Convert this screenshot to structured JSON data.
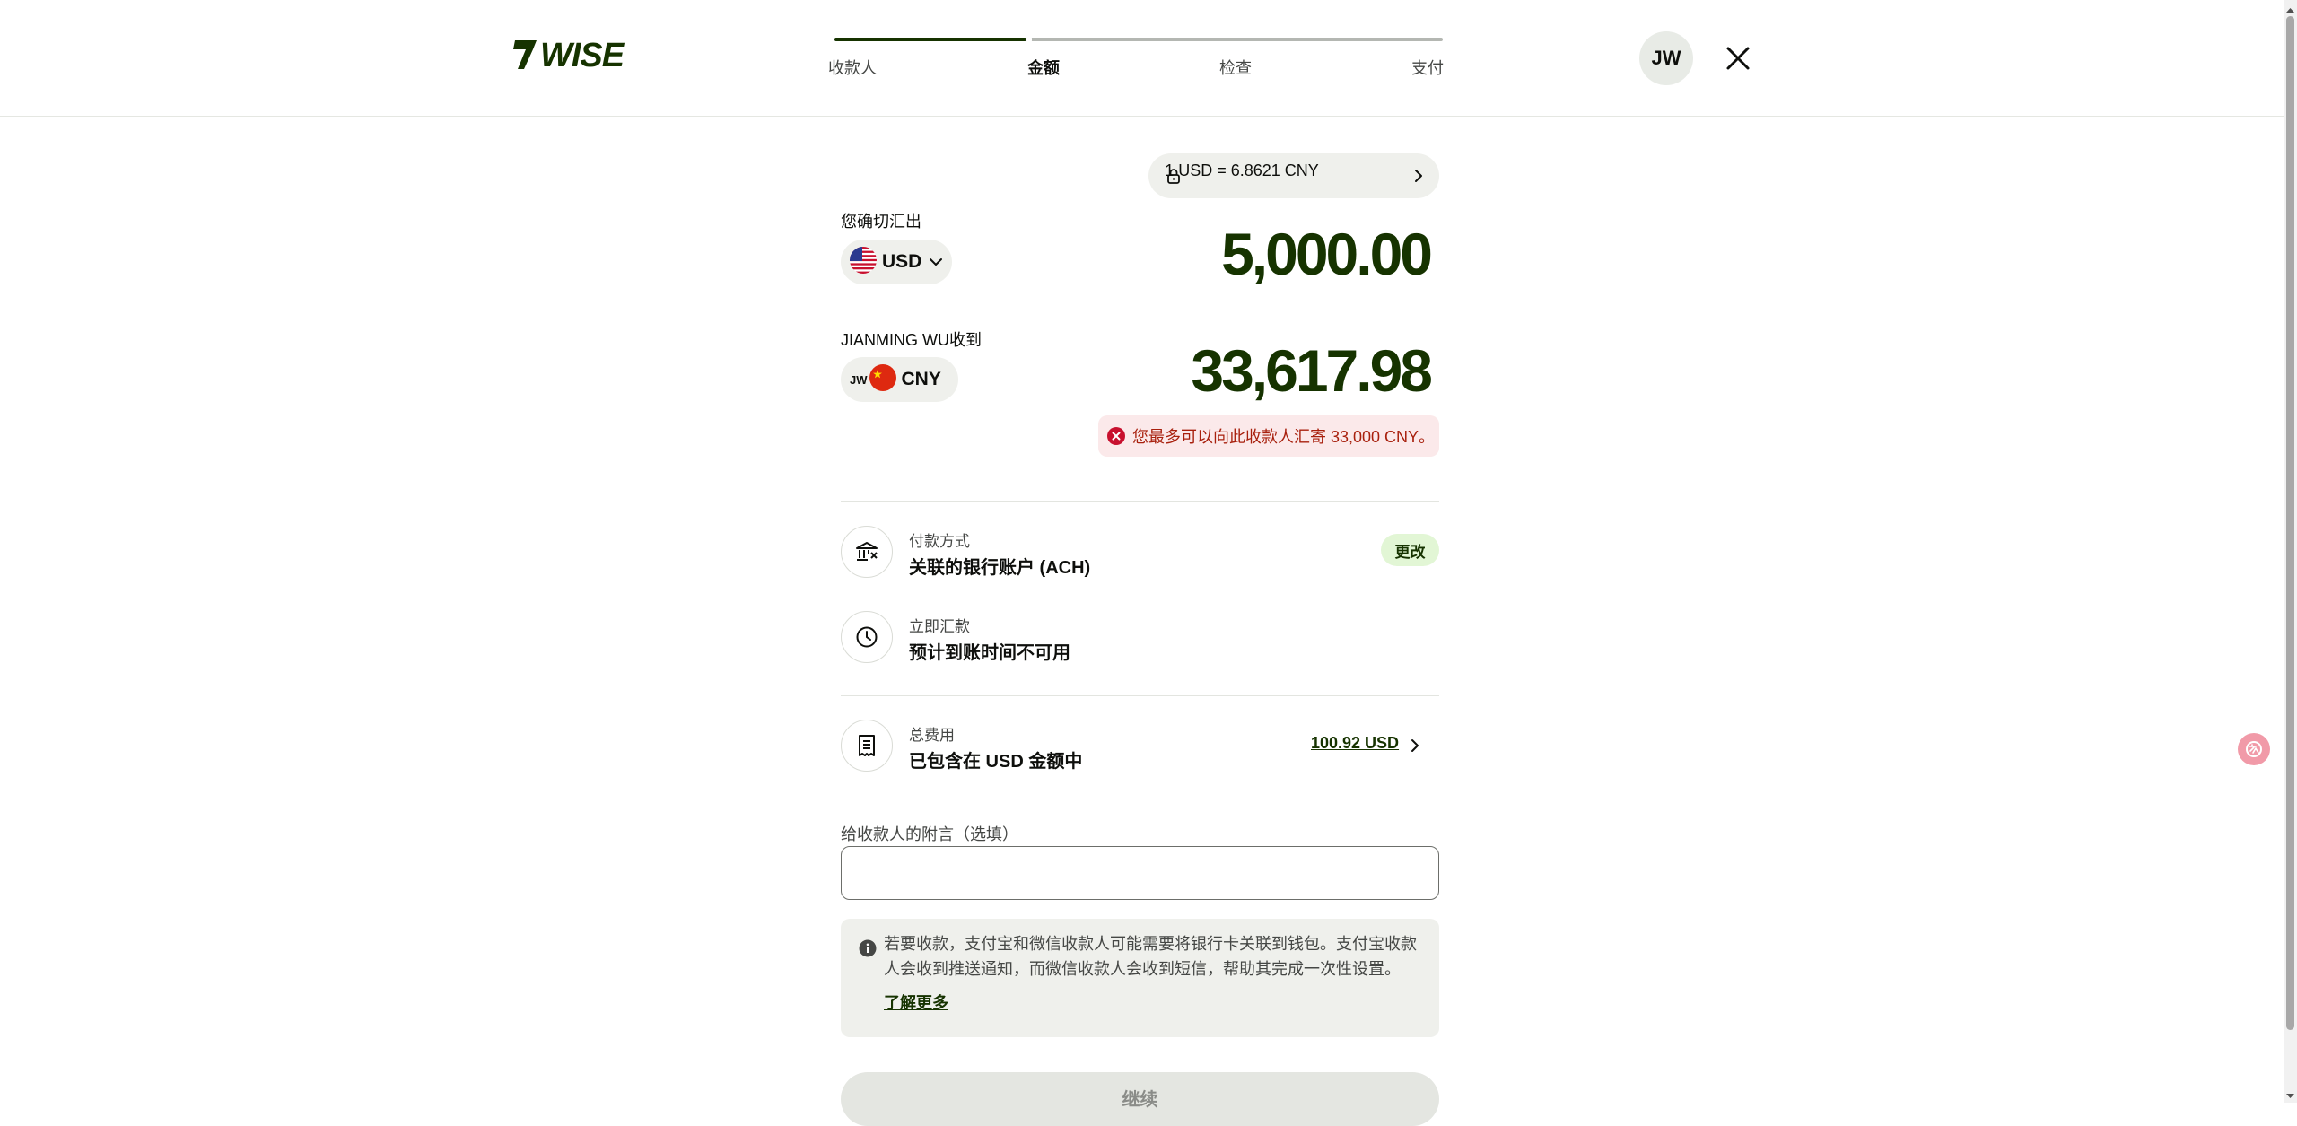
{
  "header": {
    "logo_text": "WISE",
    "steps": [
      {
        "label": "收款人",
        "state": "done"
      },
      {
        "label": "金额",
        "state": "active"
      },
      {
        "label": "检查",
        "state": "todo"
      },
      {
        "label": "支付",
        "state": "todo"
      }
    ],
    "progress": 0.33,
    "avatar_initials": "JW",
    "close_icon": "close-icon"
  },
  "rate": {
    "text": "1 USD = 6.8621 CNY",
    "lock_icon": "lock-icon",
    "chevron_icon": "chevron-right-icon"
  },
  "send": {
    "label": "您确切汇出",
    "currency": "USD",
    "flag": "us-flag-icon",
    "amount": "5,000.00"
  },
  "receive": {
    "label": "JIANMING WU收到",
    "currency": "CNY",
    "badge": "JW",
    "flag": "cn-flag-icon",
    "amount": "33,617.98"
  },
  "error": {
    "text": "您最多可以向此收款人汇寄 33,000 CNY。",
    "icon": "error-icon"
  },
  "payment": {
    "sub": "付款方式",
    "main": "关联的银行账户 (ACH)",
    "change_label": "更改",
    "icon": "bank-icon"
  },
  "timing": {
    "sub": "立即汇款",
    "main": "预计到账时间不可用",
    "icon": "clock-icon"
  },
  "fees": {
    "sub": "总费用",
    "main": "已包含在 USD 金额中",
    "link": "100.92 USD",
    "icon": "receipt-icon"
  },
  "note": {
    "label": "给收款人的附言（选填）",
    "value": "",
    "placeholder": ""
  },
  "info": {
    "text": "若要收款，支付宝和微信收款人可能需要将银行卡关联到钱包。支付宝收款人会收到推送通知，而微信收款人会收到短信，帮助其完成一次性设置。",
    "link": "了解更多",
    "icon": "info-icon"
  },
  "continue_label": "继续",
  "colors": {
    "brand_dark": "#163300",
    "accent_green": "#9fe870",
    "error": "#a8200d"
  }
}
